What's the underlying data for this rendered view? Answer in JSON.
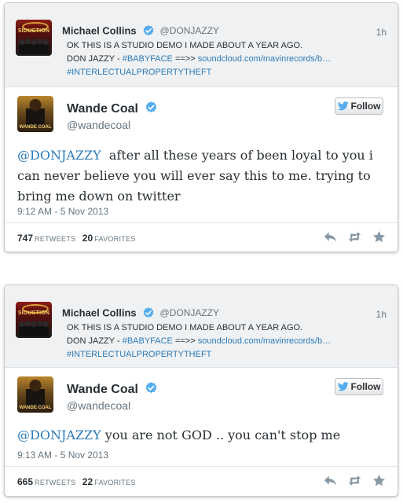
{
  "colors": {
    "link": "#2b7bb9",
    "verified": "#55acee",
    "text": "#292f33",
    "muted": "#66757f"
  },
  "cards": [
    {
      "parent": {
        "name": "Michael Collins",
        "handle": "@DONJAZZY",
        "time": "1h",
        "avatar_text": "SIDUCTION",
        "line1": "OK THIS IS A STUDIO DEMO I MADE ABOUT A YEAR AGO.",
        "line2_prefix": "DON JAZZY - ",
        "line2_hashtag": "#BABYFACE",
        "line2_arrow": " ==>> ",
        "line2_link": "soundcloud.com/mavinrecords/b…",
        "line3_hashtag": "#INTERLECTUALPROPERTYTHEFT"
      },
      "reply": {
        "name": "Wande Coal",
        "handle": "@wandecoal",
        "avatar_text": "WANDE COAL",
        "follow_label": "Follow",
        "mention": "@DONJAZZY",
        "line1": "  after all these years of been loyal to you i",
        "line2": "can never believe you will ever say this to me. trying to",
        "line3": "bring me down on twitter",
        "timestamp": "9:12 AM - 5 Nov 2013",
        "retweets": "747",
        "retweets_label": "RETWEETS",
        "favorites": "20",
        "favorites_label": "FAVORITES",
        "actions": [
          "reply-icon",
          "retweet-icon",
          "favorite-icon"
        ]
      }
    },
    {
      "parent": {
        "name": "Michael Collins",
        "handle": "@DONJAZZY",
        "time": "1h",
        "avatar_text": "SIDUCTION",
        "line1": "OK THIS IS A STUDIO DEMO I MADE ABOUT A YEAR AGO.",
        "line2_prefix": "DON JAZZY - ",
        "line2_hashtag": "#BABYFACE",
        "line2_arrow": " ==>> ",
        "line2_link": "soundcloud.com/mavinrecords/b…",
        "line3_hashtag": "#INTERLECTUALPROPERTYTHEFT"
      },
      "reply": {
        "name": "Wande Coal",
        "handle": "@wandecoal",
        "avatar_text": "WANDE COAL",
        "follow_label": "Follow",
        "mention": "@DONJAZZY",
        "line1": " you are not GOD .. you can't stop me",
        "timestamp": "9:13 AM - 5 Nov 2013",
        "retweets": "665",
        "retweets_label": "RETWEETS",
        "favorites": "22",
        "favorites_label": "FAVORITES",
        "actions": [
          "reply-icon",
          "retweet-icon",
          "favorite-icon"
        ]
      }
    }
  ]
}
